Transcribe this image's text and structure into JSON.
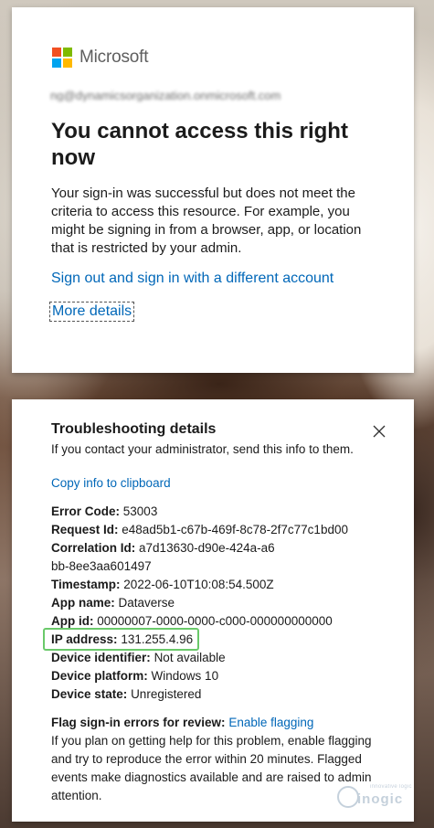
{
  "brand": {
    "name": "Microsoft",
    "colors": {
      "red": "#f25022",
      "green": "#7fba00",
      "blue": "#00a4ef",
      "yellow": "#ffb900"
    }
  },
  "account": {
    "email_masked": "ng@dynamicsorganization.onmicrosoft.com"
  },
  "error_card": {
    "title": "You cannot access this right now",
    "message": "Your sign-in was successful but does not meet the criteria to access this resource. For example, you might be signing in from a browser, app, or location that is restricted by your admin.",
    "signout_link": "Sign out and sign in with a different account",
    "more_details_link": "More details"
  },
  "troubleshooting": {
    "title": "Troubleshooting details",
    "intro": "If you contact your administrator, send this info to them.",
    "copy_link": "Copy info to clipboard",
    "close_icon": "close-icon",
    "rows": [
      {
        "label": "Error Code:",
        "value": "53003"
      },
      {
        "label": "Request Id:",
        "value": "e48ad5b1-c67b-469f-8c78-2f7c77c1bd00"
      },
      {
        "label": "Correlation Id:",
        "value": "a7d13630-d90e-424a-a6bb-8ee3aa601497"
      },
      {
        "label": "Timestamp:",
        "value": "2022-06-10T10:08:54.500Z"
      },
      {
        "label": "App name:",
        "value": "Dataverse"
      },
      {
        "label": "App id:",
        "value": "00000007-0000-0000-c000-000000000000"
      },
      {
        "label": "IP address:",
        "value": "131.255.4.96"
      },
      {
        "label": "Device identifier:",
        "value": "Not available"
      },
      {
        "label": "Device platform:",
        "value": "Windows 10"
      },
      {
        "label": "Device state:",
        "value": "Unregistered"
      }
    ],
    "flag_label": "Flag sign-in errors for review:",
    "flag_link": "Enable flagging",
    "flag_text": "If you plan on getting help for this problem, enable flagging and try to reproduce the error within 20 minutes. Flagged events make diagnostics available and are raised to admin attention."
  },
  "watermark": {
    "small": "innovative logic",
    "big": "inogic"
  },
  "highlight_color": "#6ac96a",
  "link_color": "#0067b8"
}
